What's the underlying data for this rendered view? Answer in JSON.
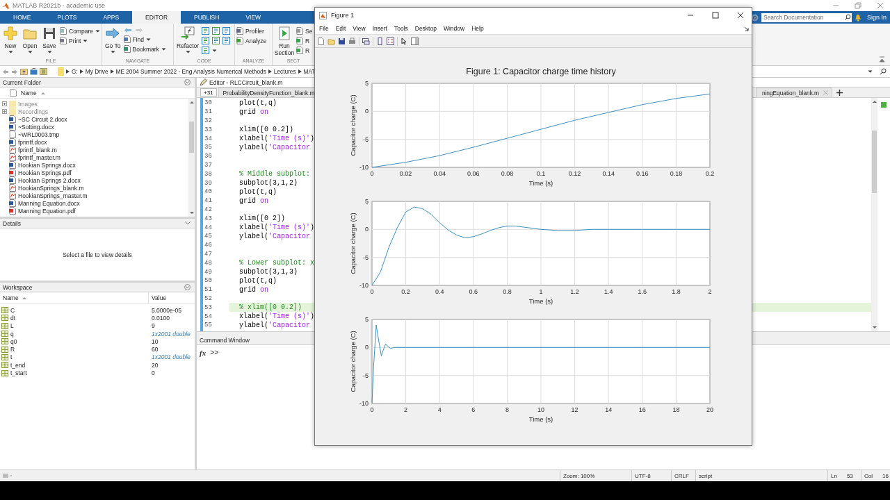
{
  "window": {
    "title": "MATLAB R2021b - academic use"
  },
  "ribbon_tabs": [
    {
      "label": "HOME",
      "selected": false
    },
    {
      "label": "PLOTS",
      "selected": false
    },
    {
      "label": "APPS",
      "selected": false
    },
    {
      "label": "EDITOR",
      "selected": true
    },
    {
      "label": "PUBLISH",
      "selected": false
    },
    {
      "label": "VIEW",
      "selected": false
    }
  ],
  "search": {
    "placeholder": "Search Documentation"
  },
  "sign_in": "Sign In",
  "toolstrip": {
    "groups": [
      {
        "label": "FILE",
        "items": [
          {
            "kind": "large",
            "label": "New",
            "dropdown": true
          },
          {
            "kind": "large",
            "label": "Open",
            "dropdown": true
          },
          {
            "kind": "large",
            "label": "Save",
            "dropdown": true
          },
          {
            "kind": "small",
            "label": "Compare",
            "dropdown": true
          },
          {
            "kind": "small",
            "label": "Print",
            "dropdown": true
          }
        ]
      },
      {
        "label": "NAVIGATE",
        "items": [
          {
            "kind": "large",
            "label": "Go To",
            "dropdown": true
          },
          {
            "kind": "arrows"
          },
          {
            "kind": "small",
            "label": "Find",
            "dropdown": true
          },
          {
            "kind": "small",
            "label": "Bookmark",
            "dropdown": true
          }
        ]
      },
      {
        "label": "CODE",
        "items": [
          {
            "kind": "large",
            "label": "Refactor",
            "dropdown": true
          },
          {
            "kind": "icons",
            "dropdown": false
          },
          {
            "kind": "icons",
            "dropdown": false
          },
          {
            "kind": "icons",
            "dropdown": true
          }
        ]
      },
      {
        "label": "ANALYZE",
        "items": [
          {
            "kind": "small",
            "label": "Profiler",
            "dropdown": false
          },
          {
            "kind": "small",
            "label": "Analyze",
            "dropdown": false
          }
        ]
      },
      {
        "label": "SECT",
        "items": [
          {
            "kind": "large",
            "label": "Run Section",
            "dropdown": false
          },
          {
            "kind": "small",
            "label": "Se",
            "dropdown": false
          },
          {
            "kind": "small",
            "label": "R",
            "dropdown": false
          },
          {
            "kind": "small",
            "label": "R",
            "dropdown": false
          }
        ]
      }
    ]
  },
  "address": {
    "path": [
      "G:",
      "My Drive",
      "ME 2004 Summer 2022 - Eng Analysis Numerical Methods",
      "Lectures",
      "MAT"
    ]
  },
  "folder": {
    "title": "Current Folder",
    "column": "Name",
    "items": [
      {
        "name": "Images",
        "kind": "folder"
      },
      {
        "name": "Recordings",
        "kind": "folder"
      },
      {
        "name": "~SC Circuit 2.docx",
        "kind": "docx"
      },
      {
        "name": "~Sotting.docx",
        "kind": "docx"
      },
      {
        "name": "~WRL0003.tmp",
        "kind": "tmp"
      },
      {
        "name": "fprintf.docx",
        "kind": "docx"
      },
      {
        "name": "fprintf_blank.m",
        "kind": "m"
      },
      {
        "name": "fprintf_master.m",
        "kind": "m"
      },
      {
        "name": "Hookian Springs.docx",
        "kind": "docx"
      },
      {
        "name": "Hookian Springs.pdf",
        "kind": "pdf"
      },
      {
        "name": "Hookian Springs 2.docx",
        "kind": "docx"
      },
      {
        "name": "HookianSprings_blank.m",
        "kind": "m"
      },
      {
        "name": "HookianSprings_master.m",
        "kind": "m"
      },
      {
        "name": "Manning Equation.docx",
        "kind": "docx"
      },
      {
        "name": "Manning Equation.pdf",
        "kind": "pdf"
      }
    ]
  },
  "details": {
    "title": "Details",
    "message": "Select a file to view details"
  },
  "workspace": {
    "title": "Workspace",
    "columns": [
      "Name",
      "Value"
    ],
    "rows": [
      {
        "name": "C",
        "value": "5.0000e-05",
        "kind": "scalar"
      },
      {
        "name": "dt",
        "value": "0.0100",
        "kind": "scalar"
      },
      {
        "name": "L",
        "value": "9",
        "kind": "scalar"
      },
      {
        "name": "q",
        "value": "1x2001 double",
        "kind": "array"
      },
      {
        "name": "q0",
        "value": "10",
        "kind": "scalar"
      },
      {
        "name": "R",
        "value": "60",
        "kind": "scalar"
      },
      {
        "name": "t",
        "value": "1x2001 double",
        "kind": "array"
      },
      {
        "name": "t_end",
        "value": "20",
        "kind": "scalar"
      },
      {
        "name": "t_start",
        "value": "0",
        "kind": "scalar"
      }
    ]
  },
  "editor": {
    "title": "Editor - RLCCircuit_blank.m",
    "tab_overflow": "+31",
    "tabs": [
      {
        "label": "ProbabilityDensityFunction_blank.m",
        "closable": false
      },
      {
        "label": "ningEquation_blank.m",
        "closable": true
      }
    ],
    "lines": [
      {
        "number": "30",
        "parts": [
          {
            "text": "plot(t,q)",
            "kind": "code"
          }
        ],
        "current": false
      },
      {
        "number": "31",
        "parts": [
          {
            "text": "grid ",
            "kind": "code"
          },
          {
            "text": "on",
            "kind": "string"
          }
        ],
        "current": false
      },
      {
        "number": "32",
        "current": false
      },
      {
        "number": "33",
        "parts": [
          {
            "text": "xlim([0 0.2])",
            "kind": "code"
          }
        ],
        "current": false
      },
      {
        "number": "34",
        "parts": [
          {
            "text": "xlabel(",
            "kind": "code"
          },
          {
            "text": "'Time (s)'",
            "kind": "string"
          },
          {
            "text": ")",
            "kind": "code"
          }
        ],
        "current": false
      },
      {
        "number": "35",
        "parts": [
          {
            "text": "ylabel(",
            "kind": "code"
          },
          {
            "text": "'Capacitor",
            "kind": "string"
          }
        ],
        "current": false
      },
      {
        "number": "36",
        "current": false
      },
      {
        "number": "37",
        "current": false
      },
      {
        "number": "38",
        "parts": [
          {
            "text": "% Middle subplot:",
            "kind": "comment"
          }
        ],
        "current": false
      },
      {
        "number": "39",
        "parts": [
          {
            "text": "subplot(3,1,2)",
            "kind": "code"
          }
        ],
        "current": false
      },
      {
        "number": "40",
        "parts": [
          {
            "text": "plot(t,q)",
            "kind": "code"
          }
        ],
        "current": false
      },
      {
        "number": "41",
        "parts": [
          {
            "text": "grid ",
            "kind": "code"
          },
          {
            "text": "on",
            "kind": "string"
          }
        ],
        "current": false
      },
      {
        "number": "42",
        "current": false
      },
      {
        "number": "43",
        "parts": [
          {
            "text": "xlim([0 2])",
            "kind": "code"
          }
        ],
        "current": false
      },
      {
        "number": "44",
        "parts": [
          {
            "text": "xlabel(",
            "kind": "code"
          },
          {
            "text": "'Time (s)'",
            "kind": "string"
          },
          {
            "text": ")",
            "kind": "code"
          }
        ],
        "current": false
      },
      {
        "number": "45",
        "parts": [
          {
            "text": "ylabel(",
            "kind": "code"
          },
          {
            "text": "'Capacitor",
            "kind": "string"
          }
        ],
        "current": false
      },
      {
        "number": "46",
        "current": false
      },
      {
        "number": "47",
        "current": false
      },
      {
        "number": "48",
        "parts": [
          {
            "text": "% Lower subplot: x",
            "kind": "comment"
          }
        ],
        "current": false
      },
      {
        "number": "49",
        "parts": [
          {
            "text": "subplot(3,1,3)",
            "kind": "code"
          }
        ],
        "current": false
      },
      {
        "number": "50",
        "parts": [
          {
            "text": "plot(t,q)",
            "kind": "code"
          }
        ],
        "current": false
      },
      {
        "number": "51",
        "parts": [
          {
            "text": "grid ",
            "kind": "code"
          },
          {
            "text": "on",
            "kind": "string"
          }
        ],
        "current": false
      },
      {
        "number": "52",
        "current": false
      },
      {
        "number": "53",
        "parts": [
          {
            "text": "% xlim([0 0.2])",
            "kind": "comment"
          }
        ],
        "current": true
      },
      {
        "number": "54",
        "parts": [
          {
            "text": "xlabel(",
            "kind": "code"
          },
          {
            "text": "'Time (s)'",
            "kind": "string"
          },
          {
            "text": ")",
            "kind": "code"
          }
        ],
        "current": false
      },
      {
        "number": "55",
        "parts": [
          {
            "text": "ylabel(",
            "kind": "code"
          },
          {
            "text": "'Capacitor",
            "kind": "string"
          }
        ],
        "current": false
      }
    ]
  },
  "command": {
    "title": "Command Window",
    "prompt_icon": "fx",
    "prompt": ">>"
  },
  "status": {
    "zoom": "Zoom: 100%",
    "encoding": "UTF-8",
    "line_ending": "CRLF",
    "file_type": "script",
    "line_label": "Ln",
    "line": "53",
    "col_label": "Col",
    "col": "16"
  },
  "figure": {
    "title": "Figure 1",
    "menus": [
      "File",
      "Edit",
      "View",
      "Insert",
      "Tools",
      "Desktop",
      "Window",
      "Help"
    ],
    "axes": [
      {
        "chart_data": {
          "type": "line",
          "title": "Figure 1: Capacitor charge time history",
          "xlabel": "Time (s)",
          "ylabel": "Capacitor charge (C)",
          "x": [
            0,
            0.02,
            0.04,
            0.06,
            0.08,
            0.1,
            0.12,
            0.14,
            0.16,
            0.18,
            0.2
          ],
          "values": [
            -10,
            -9.1,
            -7.9,
            -6.4,
            -4.8,
            -3.2,
            -1.6,
            -0.2,
            1.2,
            2.3,
            3.1
          ],
          "xlim": [
            0,
            0.2
          ],
          "ylim": [
            -10,
            5
          ],
          "grid": true,
          "xticks": [
            0,
            0.02,
            0.04,
            0.06,
            0.08,
            0.1,
            0.12,
            0.14,
            0.16,
            0.18,
            0.2
          ],
          "yticks": [
            -10,
            -5,
            0,
            5
          ]
        }
      },
      {
        "chart_data": {
          "type": "line",
          "xlabel": "Time (s)",
          "ylabel": "Capacitor charge (C)",
          "x": [
            0,
            0.05,
            0.1,
            0.15,
            0.2,
            0.25,
            0.3,
            0.35,
            0.4,
            0.45,
            0.5,
            0.55,
            0.6,
            0.65,
            0.7,
            0.75,
            0.8,
            0.85,
            0.9,
            1,
            1.1,
            1.2,
            1.3,
            1.4,
            1.6,
            1.8,
            2
          ],
          "values": [
            -10,
            -7.6,
            -3.2,
            0.3,
            3.1,
            4,
            3.7,
            2.7,
            1.2,
            -0.1,
            -1,
            -1.5,
            -1.3,
            -0.8,
            -0.2,
            0.3,
            0.6,
            0.6,
            0.4,
            0,
            -0.2,
            -0.2,
            0,
            0,
            0,
            0,
            0
          ],
          "xlim": [
            0,
            2
          ],
          "ylim": [
            -10,
            5
          ],
          "grid": true,
          "xticks": [
            0,
            0.2,
            0.4,
            0.6,
            0.8,
            1,
            1.2,
            1.4,
            1.6,
            1.8,
            2
          ],
          "yticks": [
            -10,
            -5,
            0,
            5
          ]
        }
      },
      {
        "chart_data": {
          "type": "line",
          "xlabel": "Time (s)",
          "ylabel": "Capacitor charge (C)",
          "x": [
            0,
            0.1,
            0.25,
            0.4,
            0.55,
            0.7,
            0.8,
            0.95,
            1.1,
            1.3,
            1.6,
            2,
            20
          ],
          "values": [
            -10,
            -3.2,
            4,
            1.2,
            -1.5,
            -0.2,
            0.6,
            0.2,
            -0.2,
            0,
            0,
            0,
            0
          ],
          "xlim": [
            0,
            20
          ],
          "ylim": [
            -10,
            5
          ],
          "grid": true,
          "xticks": [
            0,
            2,
            4,
            6,
            8,
            10,
            12,
            14,
            16,
            18,
            20
          ],
          "yticks": [
            -10,
            -5,
            0,
            5
          ]
        }
      }
    ]
  }
}
